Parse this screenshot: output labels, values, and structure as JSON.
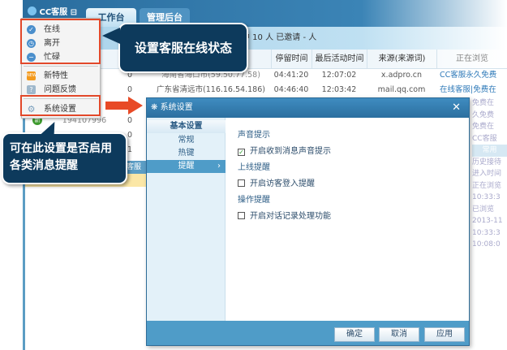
{
  "app": {
    "title": "CC客服",
    "tabs": [
      "工作台",
      "管理后台"
    ]
  },
  "subbar": {
    "text": "中 10 人  已邀请 - 人"
  },
  "table": {
    "headers": [
      "停留时间",
      "最后活动时间",
      "来源(来源词)",
      "正在浏览"
    ],
    "rows": [
      {
        "count": "0",
        "location": "海南省海口市(59.50.77.58)",
        "stay": "04:41:20",
        "last": "12:07:02",
        "source": "x.adpro.cn",
        "page": "CC客服永久免费"
      },
      {
        "count": "0",
        "location": "广东省清远市(116.16.54.186)",
        "stay": "04:46:40",
        "last": "12:03:42",
        "source": "mail.qq.com",
        "page": "在线客服|免费在"
      }
    ],
    "left_rows": [
      {
        "id": "194107996",
        "count": "0"
      },
      {
        "count": "0"
      },
      {
        "count": "1"
      }
    ],
    "left_section": "客服",
    "right_fade": [
      "免费在",
      "久免费",
      "免费在",
      "CC客服",
      "常用",
      "历史接待",
      "进入时间",
      "正在浏览",
      "10:33:3",
      "已浏览",
      "2013-11",
      "10:33:3",
      "10:08:0"
    ]
  },
  "menu": {
    "status_items": [
      {
        "icon": "check-circle-icon",
        "label": "在线"
      },
      {
        "icon": "clock-icon",
        "label": "离开"
      },
      {
        "icon": "minus-circle-icon",
        "label": "忙碌"
      }
    ],
    "other_items": [
      {
        "icon": "new-badge-icon",
        "label": "新特性"
      },
      {
        "icon": "feedback-icon",
        "label": "问题反馈"
      }
    ],
    "settings_item": {
      "icon": "gear-icon",
      "label": "系统设置"
    }
  },
  "callouts": {
    "status": "设置客服在线状态",
    "settings": "可在此设置是否启用各类消息提醒"
  },
  "dialog": {
    "title": "系统设置",
    "nav_header": "基本设置",
    "nav_items": [
      "常规",
      "热键",
      "提醒"
    ],
    "selected_nav": "提醒",
    "sections": [
      {
        "title": "声音提示",
        "option": "开启收到消息声音提示",
        "checked": true
      },
      {
        "title": "上线提醒",
        "option": "开启访客登入提醒",
        "checked": false
      },
      {
        "title": "操作提醒",
        "option": "开启对话记录处理功能",
        "checked": false
      }
    ],
    "buttons": {
      "ok": "确定",
      "cancel": "取消",
      "apply": "应用"
    }
  }
}
